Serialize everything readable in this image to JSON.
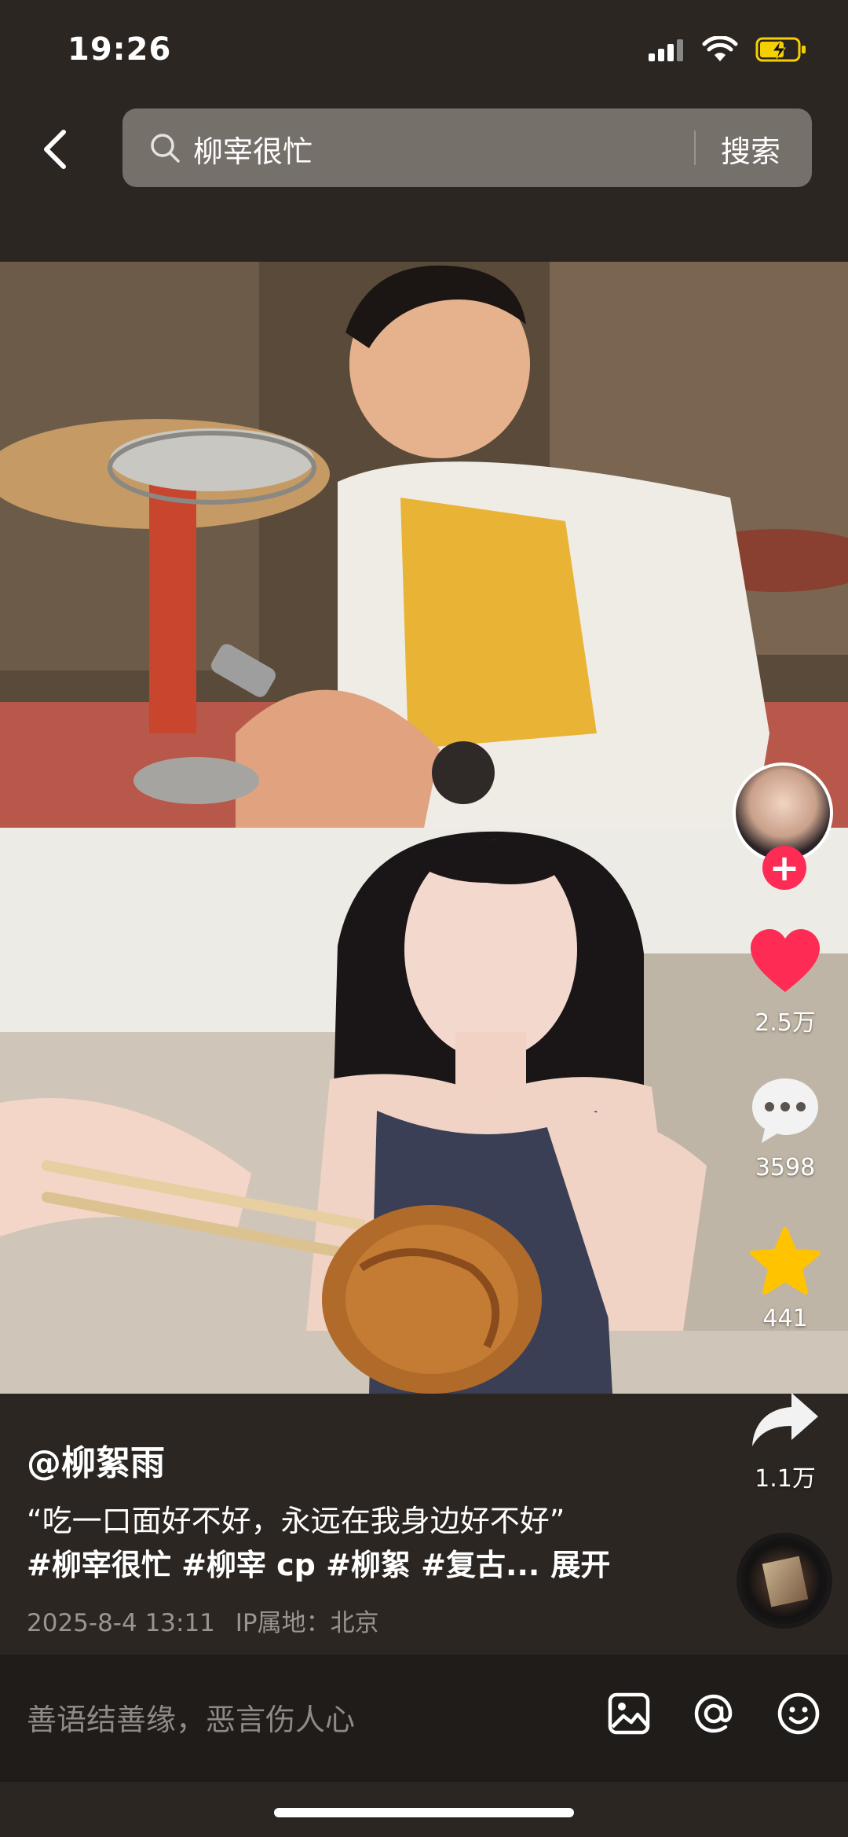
{
  "status_bar": {
    "time": "19:26"
  },
  "search": {
    "query": "柳宰很忙",
    "button_label": "搜索"
  },
  "post": {
    "author": "@柳絮雨",
    "caption_line1": "“吃一口面好不好，永远在我身边好不好”",
    "hashtags": "#柳宰很忙 #柳宰 cp #柳絮 #复古...",
    "expand_label": "展开",
    "date": "2025-8-4 13:11",
    "location": "IP属地：北京"
  },
  "actions": {
    "likes": "2.5万",
    "comments": "3598",
    "favorites": "441",
    "shares": "1.1万"
  },
  "comment_bar": {
    "placeholder": "善语结善缘，恶言伤人心"
  },
  "colors": {
    "like": "#fe2c55",
    "favorite": "#ffc300",
    "follow": "#fe2c55"
  }
}
